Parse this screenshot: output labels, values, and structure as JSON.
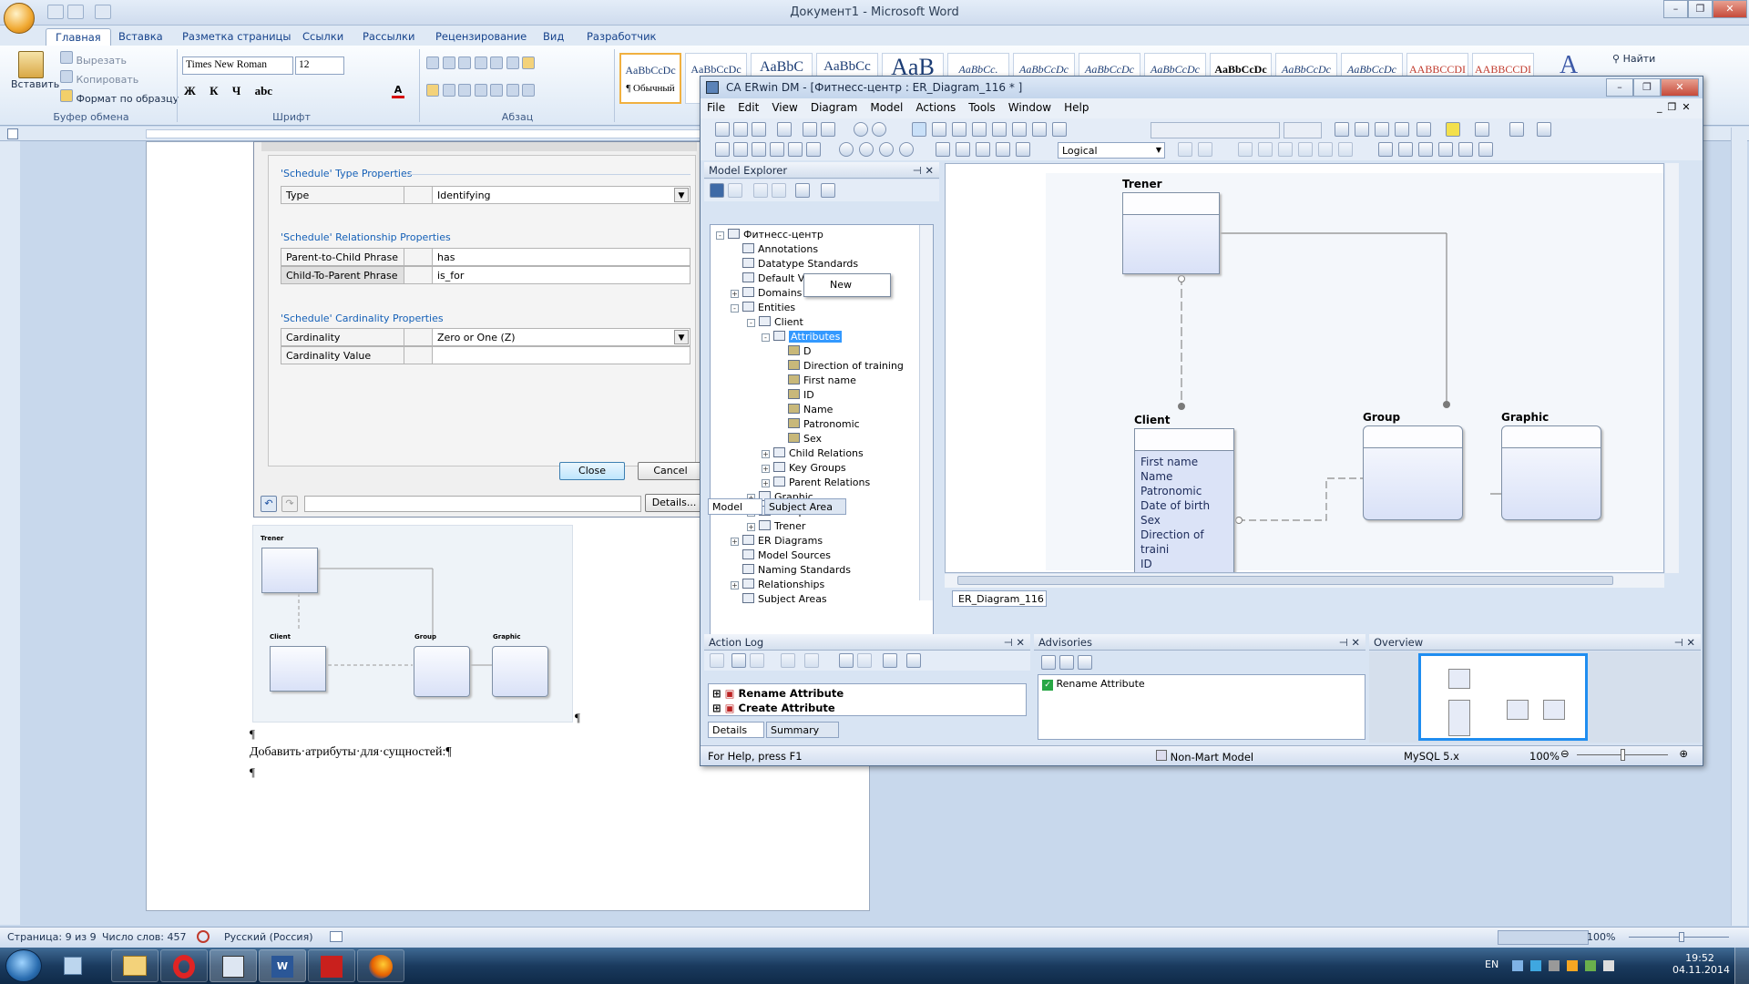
{
  "word": {
    "title": "Документ1 - Microsoft Word",
    "tabs": [
      "Главная",
      "Вставка",
      "Разметка страницы",
      "Ссылки",
      "Рассылки",
      "Рецензирование",
      "Вид",
      "Разработчик"
    ],
    "clipboard": {
      "paste": "Вставить",
      "cut": "Вырезать",
      "copy": "Копировать",
      "format_painter": "Формат по образцу",
      "group": "Буфер обмена"
    },
    "font": {
      "name": "Times New Roman",
      "size": "12",
      "group": "Шрифт"
    },
    "paragraph_group": "Абзац",
    "styles": [
      "AaBbCcDc",
      "AaBbCcDc",
      "AaBbC",
      "AaBbCc",
      "AaB",
      "AaBbCc.",
      "AaBbCcDc",
      "AaBbCcDc",
      "AaBbCcDc",
      "AaBbCcDc",
      "AaBbCcDc",
      "AaBbCcDc",
      "AaBbCcDc",
      "AABBCCDI",
      "AABBCCDI"
    ],
    "style_active_label": "¶ Обычный",
    "find": "Найти",
    "doc_text": "Добавить·атрибуты·для·сущностей:¶",
    "pilcrow": "¶",
    "status": {
      "page": "Страница: 9 из 9",
      "words": "Число слов: 457",
      "lang": "Русский (Россия)",
      "zoom": "100%"
    }
  },
  "dialog": {
    "sec1": "'Schedule' Type Properties",
    "type_key": "Type",
    "type_val": "Identifying",
    "sec2": "'Schedule' Relationship Properties",
    "p2c_key": "Parent-to-Child Phrase",
    "p2c_val": "has",
    "c2p_key": "Child-To-Parent Phrase",
    "c2p_val": "is_for",
    "sec3": "'Schedule' Cardinality Properties",
    "card_key": "Cardinality",
    "card_val": "Zero or One (Z)",
    "cardv_key": "Cardinality Value",
    "cardv_val": "",
    "close": "Close",
    "cancel": "Cancel",
    "details": "Details..."
  },
  "thumb_labels": [
    "Trener",
    "Client",
    "Group",
    "Graphic"
  ],
  "erwin": {
    "title": "CA ERwin DM - [Фитнесс-центр : ER_Diagram_116 * ]",
    "menu": [
      "File",
      "Edit",
      "View",
      "Diagram",
      "Model",
      "Actions",
      "Tools",
      "Window",
      "Help"
    ],
    "notation": "Logical",
    "explorer_title": "Model Explorer",
    "tree": [
      {
        "t": "Фитнесс-центр",
        "lvl": 0,
        "pm": "-"
      },
      {
        "t": "Annotations",
        "lvl": 1,
        "pm": ""
      },
      {
        "t": "Datatype Standards",
        "lvl": 1,
        "pm": ""
      },
      {
        "t": "Default Values",
        "lvl": 1,
        "pm": ""
      },
      {
        "t": "Domains",
        "lvl": 1,
        "pm": "+"
      },
      {
        "t": "Entities",
        "lvl": 1,
        "pm": "-"
      },
      {
        "t": "Client",
        "lvl": 2,
        "pm": "-"
      },
      {
        "t": "Attributes",
        "lvl": 3,
        "pm": "-"
      },
      {
        "t": "D",
        "lvl": 4,
        "pm": ""
      },
      {
        "t": "Direction of training",
        "lvl": 4,
        "pm": ""
      },
      {
        "t": "First name",
        "lvl": 4,
        "pm": ""
      },
      {
        "t": "ID",
        "lvl": 4,
        "pm": ""
      },
      {
        "t": "Name",
        "lvl": 4,
        "pm": ""
      },
      {
        "t": "Patronomic",
        "lvl": 4,
        "pm": ""
      },
      {
        "t": "Sex",
        "lvl": 4,
        "pm": ""
      },
      {
        "t": "Child Relations",
        "lvl": 3,
        "pm": "+"
      },
      {
        "t": "Key Groups",
        "lvl": 3,
        "pm": "+"
      },
      {
        "t": "Parent Relations",
        "lvl": 3,
        "pm": "+"
      },
      {
        "t": "Graphic",
        "lvl": 2,
        "pm": "+"
      },
      {
        "t": "Group",
        "lvl": 2,
        "pm": "+"
      },
      {
        "t": "Trener",
        "lvl": 2,
        "pm": "+"
      },
      {
        "t": "ER Diagrams",
        "lvl": 1,
        "pm": "+"
      },
      {
        "t": "Model Sources",
        "lvl": 1,
        "pm": ""
      },
      {
        "t": "Naming Standards",
        "lvl": 1,
        "pm": ""
      },
      {
        "t": "Relationships",
        "lvl": 1,
        "pm": "+"
      },
      {
        "t": "Subject Areas",
        "lvl": 1,
        "pm": ""
      }
    ],
    "context_menu": "New",
    "explorer_tabs": [
      "Model",
      "Subject Area"
    ],
    "diagram_tab": "ER_Diagram_116",
    "entities": {
      "trener": "Trener",
      "client": "Client",
      "group": "Group",
      "graphic": "Graphic"
    },
    "client_attrs": [
      "First name",
      "Name",
      "Patronomic",
      "Date of birth",
      "Sex",
      "Direction of traini",
      "ID"
    ],
    "action_log_title": "Action Log",
    "action_log": [
      "Rename Attribute",
      "Create Attribute"
    ],
    "action_tabs": [
      "Details",
      "Summary"
    ],
    "advisories_title": "Advisories",
    "advisory": "Rename Attribute",
    "overview_title": "Overview",
    "status": {
      "help": "For Help, press F1",
      "model": "Non-Mart Model",
      "db": "MySQL 5.x",
      "zoom": "100%"
    }
  },
  "taskbar": {
    "lang": "EN",
    "time": "19:52",
    "date": "04.11.2014"
  }
}
